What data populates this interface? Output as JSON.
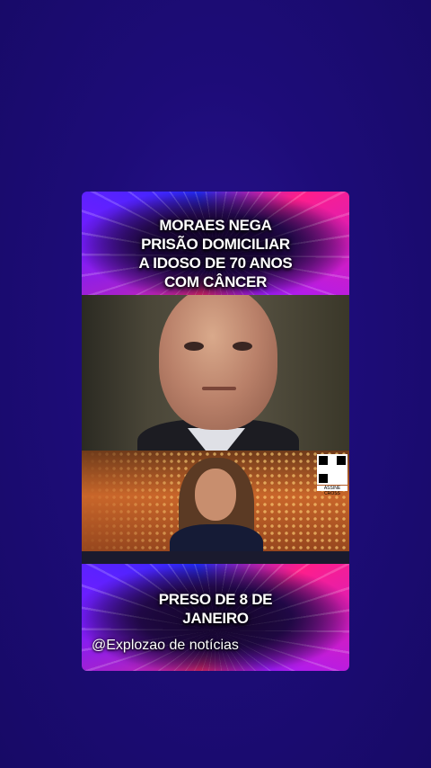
{
  "post": {
    "top_headline": [
      "MORAES NEGA",
      "PRISÃO DOMICILIAR",
      "A IDOSO DE 70 ANOS",
      "COM CÂNCER"
    ],
    "bottom_headline": [
      "PRESO DE 8 DE",
      "JANEIRO"
    ],
    "credit": "@Explozao de notícias",
    "qr_label": "ASSINE CROSS"
  },
  "colors": {
    "background": "#1d0c78",
    "banner_accent_pink": "#ff2b6a",
    "banner_accent_purple": "#7a1cff"
  }
}
